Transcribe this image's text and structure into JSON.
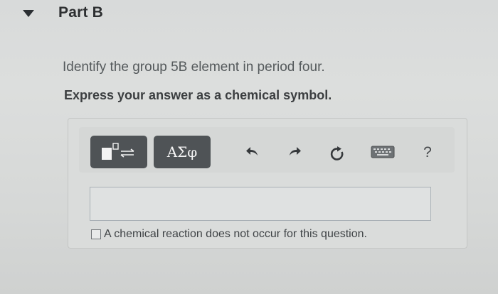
{
  "part": {
    "title": "Part B",
    "toggle_icon": "triangle-down-icon"
  },
  "question": {
    "prompt": "Identify the group 5B element in period four.",
    "instruction": "Express your answer as a chemical symbol."
  },
  "toolbar": {
    "greek_label": "ΑΣφ",
    "help_label": "?",
    "icons": {
      "templates": "templates-icon",
      "undo": "undo-icon",
      "redo": "redo-icon",
      "reset": "reset-icon",
      "keyboard": "keyboard-icon"
    }
  },
  "answer": {
    "value": "",
    "no_reaction_label": "A chemical reaction does not occur for this question.",
    "no_reaction_checked": false
  }
}
